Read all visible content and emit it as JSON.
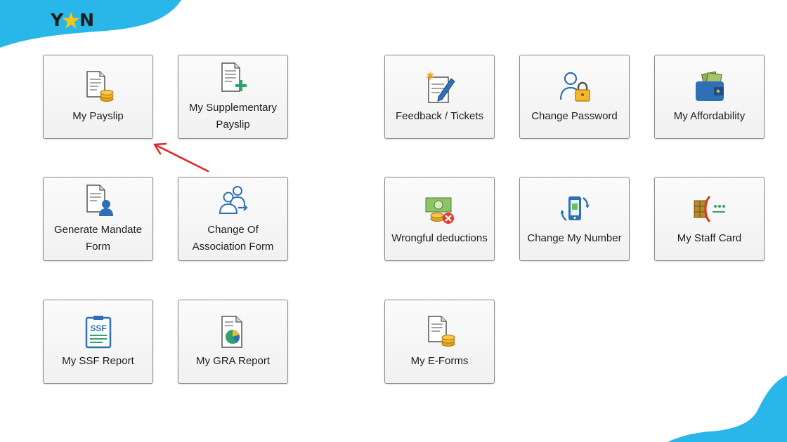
{
  "brand": {
    "logo_left": "Y",
    "logo_right": "N",
    "accent_color": "#29b6e8",
    "star_color": "#f5c518"
  },
  "tiles": [
    {
      "label": "My Payslip",
      "icon": "payslip-icon"
    },
    {
      "label": "My Supplementary Payslip",
      "icon": "supplementary-payslip-icon"
    },
    {
      "label": "Generate Mandate Form",
      "icon": "mandate-form-icon"
    },
    {
      "label": "Change Of Association Form",
      "icon": "association-form-icon"
    },
    {
      "label": "My SSF Report",
      "icon": "ssf-report-icon"
    },
    {
      "label": "My GRA Report",
      "icon": "gra-report-icon"
    },
    {
      "label": "Feedback / Tickets",
      "icon": "feedback-icon"
    },
    {
      "label": "Change Password",
      "icon": "password-icon"
    },
    {
      "label": "My Affordability",
      "icon": "wallet-icon"
    },
    {
      "label": "Wrongful deductions",
      "icon": "wrongful-deductions-icon"
    },
    {
      "label": "Change My Number",
      "icon": "phone-icon"
    },
    {
      "label": "My Staff Card",
      "icon": "staff-card-icon"
    },
    {
      "label": "My E-Forms",
      "icon": "eforms-icon"
    }
  ],
  "icon_text": {
    "ssf": "SSF"
  },
  "annotation": {
    "arrow_color": "#e0282e",
    "points_to": "My Payslip"
  }
}
